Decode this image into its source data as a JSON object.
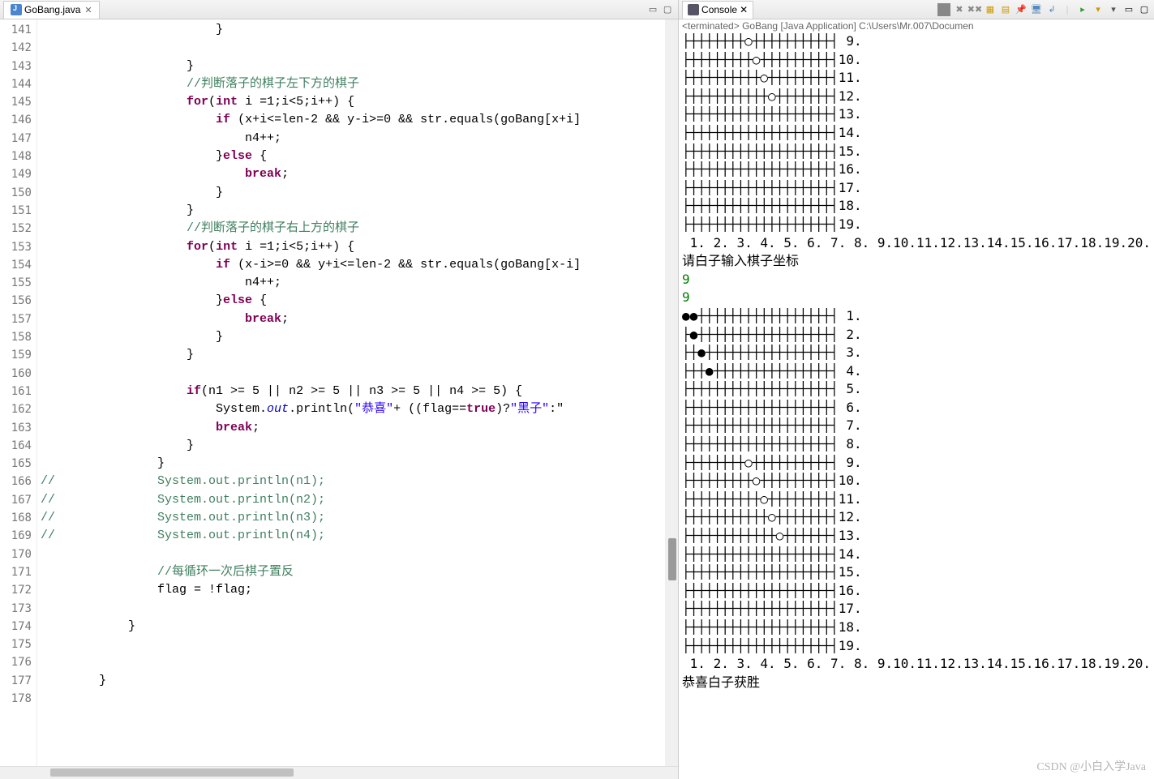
{
  "editor": {
    "tab_label": "GoBang.java",
    "line_start": 141,
    "line_end": 178,
    "code_lines": [
      "                        }",
      "",
      "                    }",
      "                    //判断落子的棋子左下方的棋子",
      "                    for(int i =1;i<5;i++) {",
      "                        if (x+i<=len-2 && y-i>=0 && str.equals(goBang[x+i]",
      "                            n4++;",
      "                        }else {",
      "                            break;",
      "                        }",
      "                    }",
      "                    //判断落子的棋子右上方的棋子",
      "                    for(int i =1;i<5;i++) {",
      "                        if (x-i>=0 && y+i<=len-2 && str.equals(goBang[x-i]",
      "                            n4++;",
      "                        }else {",
      "                            break;",
      "                        }",
      "                    }",
      "",
      "                    if(n1 >= 5 || n2 >= 5 || n3 >= 5 || n4 >= 5) {",
      "                        System.out.println(\"恭喜\"+ ((flag==true)?\"黑子\":\"",
      "                        break;",
      "                    }",
      "                }",
      "//              System.out.println(n1);",
      "//              System.out.println(n2);",
      "//              System.out.println(n3);",
      "//              System.out.println(n4);",
      "",
      "                //每循环一次后棋子置反",
      "                flag = !flag;",
      "",
      "            }",
      "",
      "",
      "        }",
      ""
    ]
  },
  "console": {
    "tab_label": "Console",
    "status": "<terminated> GoBang [Java Application] C:\\Users\\Mr.007\\Documen",
    "board1_rows_start": 9,
    "board1_rows_end": 19,
    "board1_white": [
      [
        9,
        9
      ],
      [
        10,
        10
      ],
      [
        11,
        11
      ],
      [
        12,
        12
      ]
    ],
    "board1_black": [],
    "x_labels": "1. 2. 3. 4. 5. 6. 7. 8. 9.10.11.12.13.14.15.16.17.18.19.20.",
    "prompt": "请白子输入棋子坐标",
    "input1": "9",
    "input2": "9",
    "board2_rows_start": 1,
    "board2_rows_end": 19,
    "board2_white": [
      [
        9,
        9
      ],
      [
        10,
        10
      ],
      [
        11,
        11
      ],
      [
        12,
        12
      ],
      [
        13,
        13
      ]
    ],
    "board2_black": [
      [
        1,
        1
      ],
      [
        1,
        2
      ],
      [
        2,
        2
      ],
      [
        3,
        3
      ],
      [
        4,
        4
      ]
    ],
    "win_msg": "恭喜白子获胜"
  },
  "watermark": "CSDN @小白入学Java"
}
